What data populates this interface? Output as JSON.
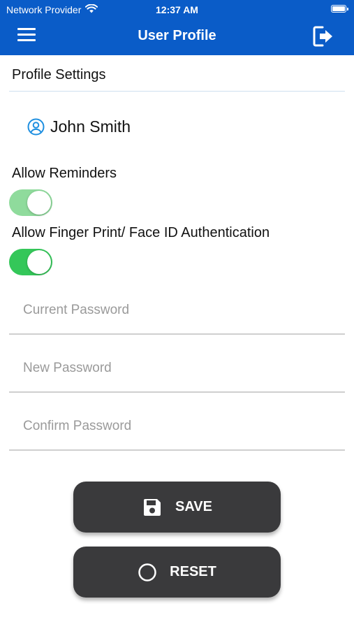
{
  "status_bar": {
    "carrier": "Network Provider",
    "time": "12:37 AM"
  },
  "header": {
    "title": "User Profile",
    "menu_icon": "hamburger-menu-icon",
    "logout_icon": "logout-icon",
    "background_color": "#0a5cc8"
  },
  "profile": {
    "section_title": "Profile Settings",
    "user_name": "John Smith",
    "user_icon": "user-circle-icon"
  },
  "settings": {
    "reminders_label": "Allow Reminders",
    "reminders_on": true,
    "reminders_color": "#8fdb9c",
    "biometric_label": "Allow Finger Print/ Face ID Authentication",
    "biometric_on": true,
    "biometric_color": "#34c759"
  },
  "password_form": {
    "current_placeholder": "Current Password",
    "new_placeholder": "New Password",
    "confirm_placeholder": "Confirm Password"
  },
  "actions": {
    "save_label": "SAVE",
    "save_icon": "floppy-disk-icon",
    "reset_label": "RESET",
    "reset_icon": "circle-icon"
  }
}
